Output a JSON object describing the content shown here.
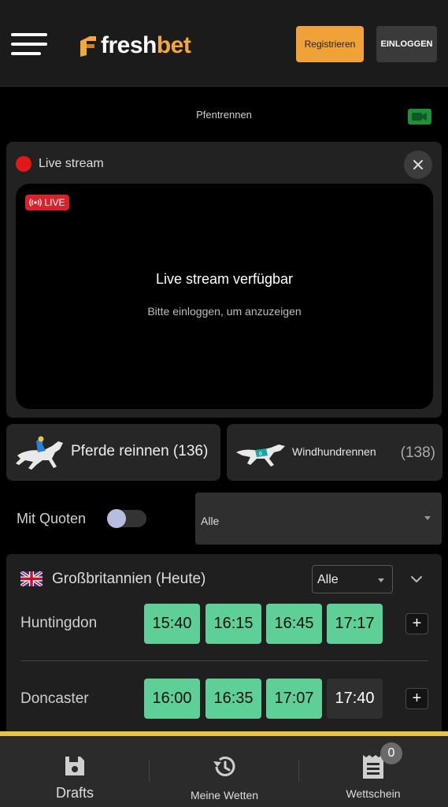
{
  "header": {
    "logo_fresh": "fresh",
    "logo_bet": "bet",
    "register_label": "Registrieren",
    "login_label": "EINLOGGEN"
  },
  "subheader": {
    "title": "Pfentrennen"
  },
  "stream": {
    "title": "Live stream",
    "live_badge": "LIVE",
    "heading": "Live stream verfügbar",
    "subtext": "Bitte einloggen, um anzuzeigen"
  },
  "sports": [
    {
      "label": "Pferde reinnen (136)"
    },
    {
      "label": "Windhundrennen",
      "count": "(138)"
    }
  ],
  "filters": {
    "quoten_label": "Mit Quoten",
    "quoten_on": false,
    "select_value": "Alle"
  },
  "region": {
    "title": "Großbritannien (Heute)",
    "select_value": "Alle",
    "venues": [
      {
        "name": "Huntingdon",
        "times": [
          "15:40",
          "16:15",
          "16:45",
          "17:17"
        ]
      },
      {
        "name": "Doncaster",
        "times": [
          "16:00",
          "16:35",
          "17:07",
          "17:40"
        ]
      }
    ]
  },
  "bottom_nav": {
    "drafts": "Drafts",
    "my_bets": "Meine Wetten",
    "betslip": "Wettschein",
    "betslip_count": "0"
  },
  "colors": {
    "accent": "#f0a238",
    "odds_green": "#5fcf98",
    "live_red": "#d9222a",
    "nav_border": "#e8c545"
  }
}
